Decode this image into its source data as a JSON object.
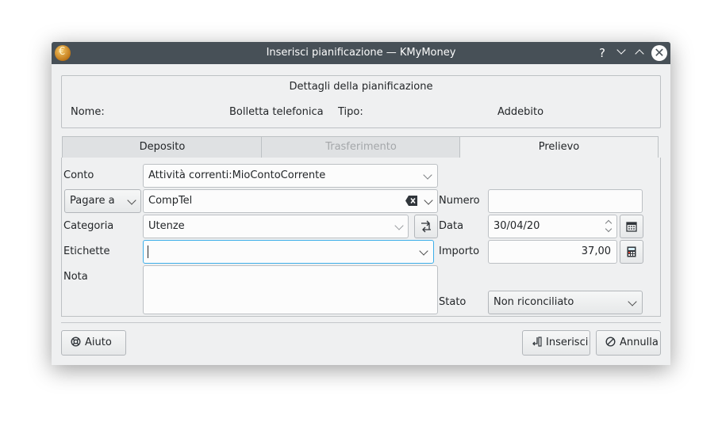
{
  "window": {
    "title": "Inserisci pianificazione — KMyMoney",
    "help_glyph": "?",
    "minimize_glyph": "⌄",
    "maximize_glyph": "⌃",
    "close_glyph": "✕",
    "app_icon": "kmymoney-logo-icon"
  },
  "details": {
    "heading": "Dettagli della pianificazione",
    "name_label": "Nome:",
    "name_value": "Bolletta telefonica",
    "type_label": "Tipo:",
    "type_value": "Addebito"
  },
  "tabs": [
    {
      "label": "Deposito",
      "state": "inactive"
    },
    {
      "label": "Trasferimento",
      "state": "disabled"
    },
    {
      "label": "Prelievo",
      "state": "active"
    }
  ],
  "form": {
    "account_label": "Conto",
    "account_value": "Attività correnti:MioContoCorrente",
    "payee_mode": "Pagare a",
    "payee_value": "CompTel",
    "category_label": "Categoria",
    "category_value": "Utenze",
    "tags_label": "Etichette",
    "tags_value": "",
    "memo_label": "Nota",
    "memo_value": "",
    "number_label": "Numero",
    "number_value": "",
    "date_label": "Data",
    "date_value": "30/04/20",
    "amount_label": "Importo",
    "amount_value": "37,00",
    "status_label": "Stato",
    "status_value": "Non riconciliato"
  },
  "buttons": {
    "help": "Aiuto",
    "insert": "Inserisci",
    "cancel": "Annulla"
  },
  "colors": {
    "titlebar": "#475057",
    "window_bg": "#eff0f1",
    "field_bg": "#fcfcfc",
    "disabled_text": "#a4a7aa"
  }
}
